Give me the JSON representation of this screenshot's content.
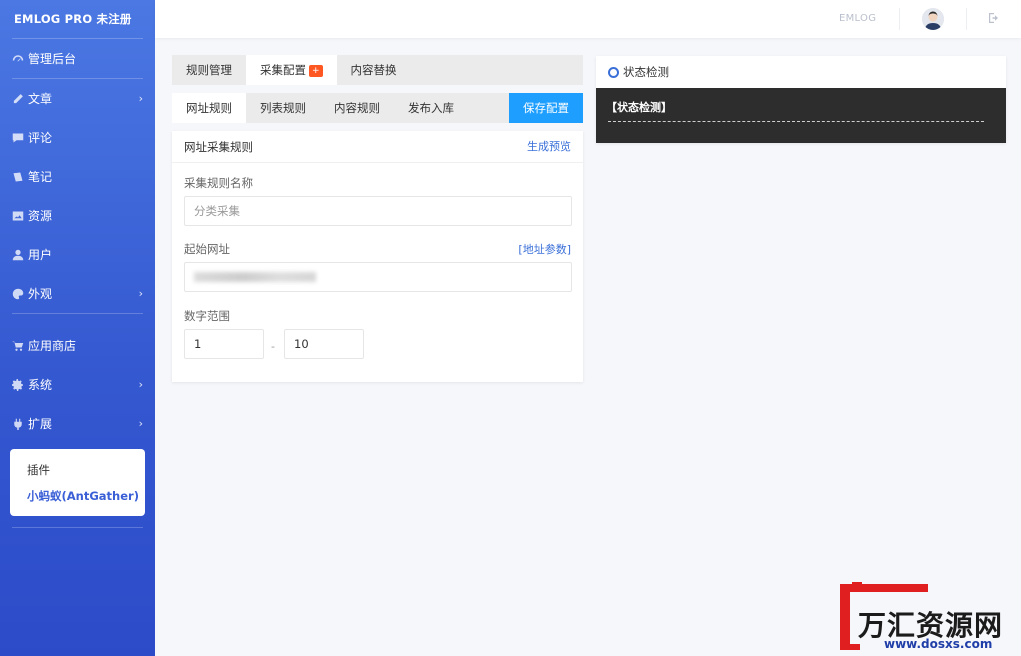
{
  "sidebar": {
    "brand": "EMLOG PRO 未注册",
    "items": [
      {
        "label": "管理后台",
        "icon": "dashboard-icon"
      },
      {
        "label": "文章",
        "icon": "pencil-icon",
        "arrow": "›"
      },
      {
        "label": "评论",
        "icon": "comment-icon"
      },
      {
        "label": "笔记",
        "icon": "note-icon"
      },
      {
        "label": "资源",
        "icon": "image-icon"
      },
      {
        "label": "用户",
        "icon": "user-icon"
      },
      {
        "label": "外观",
        "icon": "palette-icon",
        "arrow": "›"
      },
      {
        "label": "应用商店",
        "icon": "cart-icon"
      },
      {
        "label": "系统",
        "icon": "gear-icon",
        "arrow": "›"
      },
      {
        "label": "扩展",
        "icon": "plug-icon",
        "arrow": "›"
      }
    ],
    "submenu": [
      "插件",
      "小蚂蚁(AntGather)"
    ]
  },
  "header": {
    "site_label": "EMLOG"
  },
  "tabs_top": [
    {
      "label": "规则管理"
    },
    {
      "label": "采集配置",
      "badge": "+"
    },
    {
      "label": "内容替换"
    }
  ],
  "tabs_sub": [
    {
      "label": "网址规则"
    },
    {
      "label": "列表规则"
    },
    {
      "label": "内容规则"
    },
    {
      "label": "发布入库"
    }
  ],
  "save_label": "保存配置",
  "form": {
    "title": "网址采集规则",
    "preview_link": "生成预览",
    "name_label": "采集规则名称",
    "name_placeholder": "分类采集",
    "url_label": "起始网址",
    "url_param_link": "[地址参数]",
    "range_label": "数字范围",
    "range_from": "1",
    "range_sep": "-",
    "range_to": "10"
  },
  "status": {
    "title": "状态检测",
    "body_title": "【状态检测】"
  },
  "watermark": {
    "text": "万汇资源网",
    "url": "www.dosxs.com"
  },
  "colors": {
    "sidebar_top": "#4b78e3",
    "sidebar_bottom": "#2c4bc9",
    "accent": "#1e9fff",
    "link": "#3a6fd8",
    "badge": "#ff5722",
    "console_bg": "#2d2d2d"
  }
}
